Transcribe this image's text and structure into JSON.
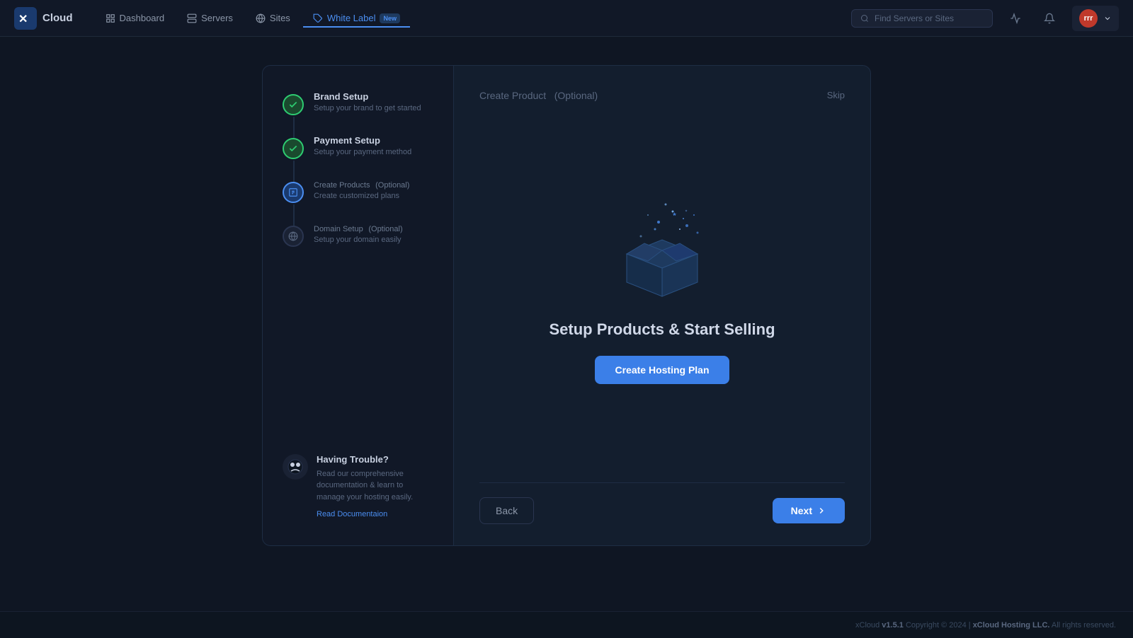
{
  "app": {
    "logo_text": "Cloud",
    "version": "v1.5.1",
    "copyright": "Copyright © 2024 | xCloud Hosting LLC. All rights reserved.",
    "footer_text": "xCloud v1.5.1  Copyright © 2024 | xCloud Hosting LLC. All rights reserved."
  },
  "nav": {
    "links": [
      {
        "id": "dashboard",
        "label": "Dashboard",
        "active": false
      },
      {
        "id": "servers",
        "label": "Servers",
        "active": false
      },
      {
        "id": "sites",
        "label": "Sites",
        "active": false
      },
      {
        "id": "white-label",
        "label": "White Label",
        "active": true,
        "badge": "New"
      }
    ],
    "search_placeholder": "Find Servers or Sites",
    "user_initials": "rrr"
  },
  "wizard": {
    "steps": [
      {
        "id": "brand-setup",
        "title": "Brand Setup",
        "optional": false,
        "subtitle": "Setup your brand to get started",
        "status": "done"
      },
      {
        "id": "payment-setup",
        "title": "Payment Setup",
        "optional": false,
        "subtitle": "Setup your payment method",
        "status": "done"
      },
      {
        "id": "create-products",
        "title": "Create Products",
        "optional": true,
        "optional_label": "(Optional)",
        "subtitle": "Create customized plans",
        "status": "active"
      },
      {
        "id": "domain-setup",
        "title": "Domain Setup",
        "optional": true,
        "optional_label": "(Optional)",
        "subtitle": "Setup your domain easily",
        "status": "pending"
      }
    ],
    "help": {
      "title": "Having Trouble?",
      "text": "Read our comprehensive documentation & learn to manage your hosting easily.",
      "link_text": "Read Documentaion"
    },
    "panel": {
      "title": "Create Product",
      "optional_label": "(Optional)",
      "skip_label": "Skip",
      "cta_title": "Setup Products & Start Selling",
      "create_btn_label": "Create Hosting Plan",
      "back_btn_label": "Back",
      "next_btn_label": "Next"
    }
  }
}
